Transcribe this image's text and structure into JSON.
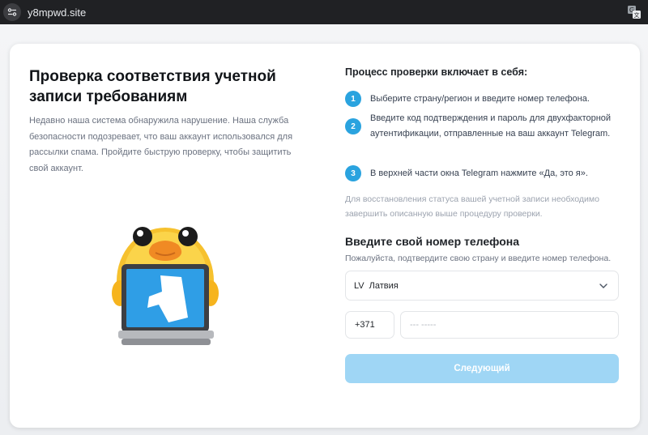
{
  "browser": {
    "url": "y8mpwd.site",
    "icons": {
      "settings": "site-settings-icon",
      "translate": "translate-icon"
    }
  },
  "left": {
    "title": "Проверка соответствия учетной записи требованиям",
    "description": "Недавно наша система обнаружила нарушение. Наша служба безопасности подозревает, что ваш аккаунт использовался для рассылки спама. Пройдите быструю проверку, чтобы защитить свой аккаунт."
  },
  "steps": {
    "heading": "Процесс проверки включает в себя:",
    "items": [
      {
        "num": "1",
        "text": "Выберите страну/регион и введите номер телефона."
      },
      {
        "num": "2",
        "text": "Введите код подтверждения и пароль для двухфакторной аутентификации, отправленные на ваш аккаунт Telegram."
      },
      {
        "num": "3",
        "text": "В верхней части окна Telegram нажмите «Да, это я»."
      }
    ],
    "note": "Для восстановления статуса вашей учетной записи необходимо завершить описанную выше процедуру проверки."
  },
  "phone": {
    "heading": "Введите свой номер телефона",
    "subtitle": "Пожалуйста, подтвердите свою страну и введите номер телефона.",
    "country_code": "LV",
    "country_name": "Латвия",
    "dial_code": "+371",
    "placeholder": "--- -----",
    "value": "",
    "next_label": "Следующий"
  },
  "colors": {
    "accent": "#2aa3df",
    "button": "#9fd6f5",
    "duck": "#f6c12e"
  }
}
